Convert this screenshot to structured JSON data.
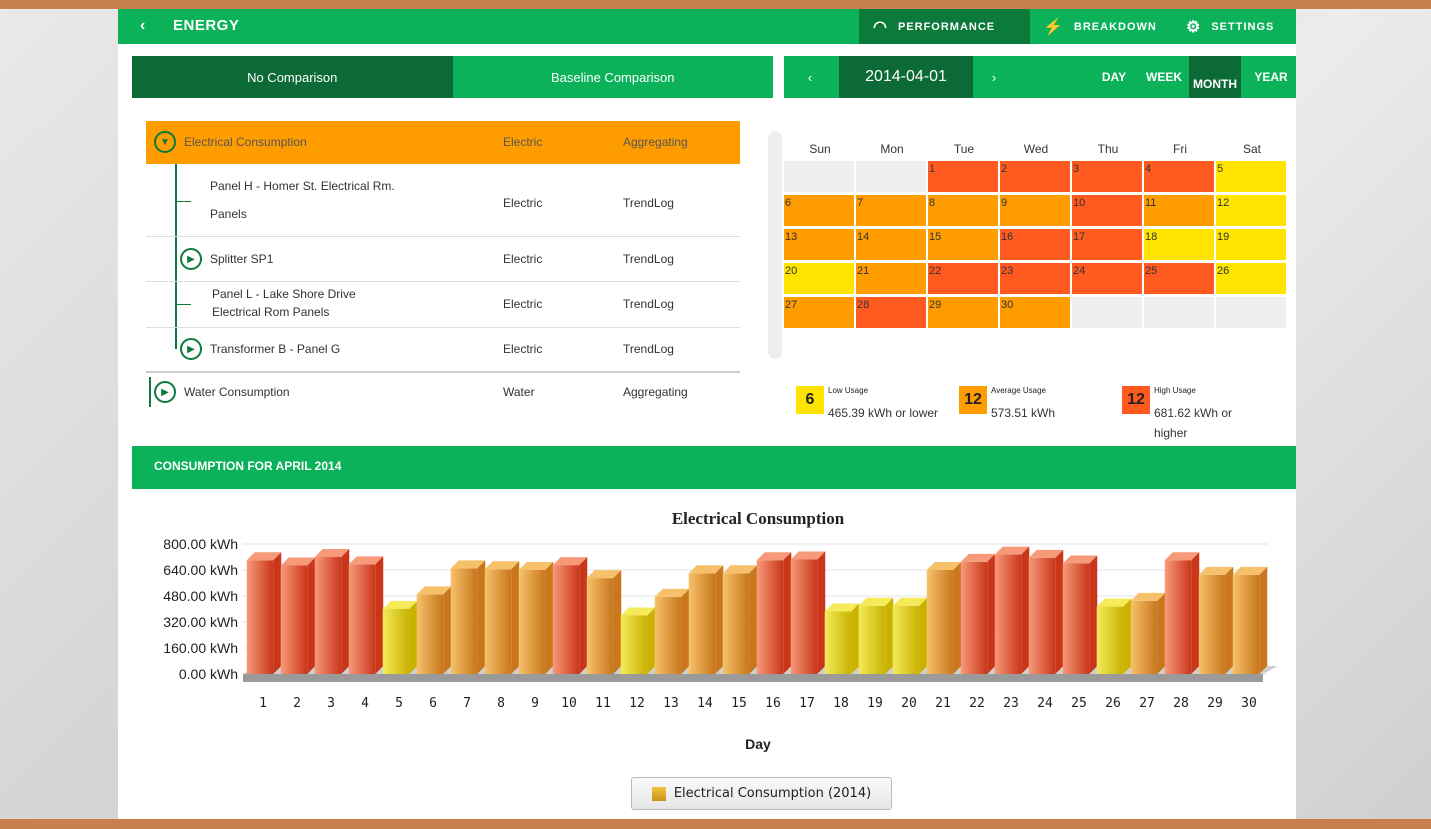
{
  "header": {
    "back_icon": "‹",
    "title": "ENERGY",
    "nav": [
      {
        "icon": "speedometer-icon",
        "label": "PERFORMANCE"
      },
      {
        "icon": "lightning-icon",
        "label": "BREAKDOWN"
      },
      {
        "icon": "gear-icon",
        "label": "SETTINGS"
      }
    ]
  },
  "comparison_tabs": [
    "No Comparison",
    "Baseline Comparison"
  ],
  "tree": [
    {
      "name": "Electrical Consumption",
      "type": "Electric",
      "mode": "Aggregating"
    },
    {
      "name_line1": "Panel H - Homer St. Electrical Rm.",
      "name_line2": "Panels",
      "type": "Electric",
      "mode": "TrendLog"
    },
    {
      "name": "Splitter SP1",
      "type": "Electric",
      "mode": "TrendLog"
    },
    {
      "name_line1": "Panel L - Lake Shore Drive",
      "name_line2": "Electrical Rom Panels",
      "type": "Electric",
      "mode": "TrendLog"
    },
    {
      "name": "Transformer B - Panel G",
      "type": "Electric",
      "mode": "TrendLog"
    },
    {
      "name": "Water Consumption",
      "type": "Water",
      "mode": "Aggregating"
    }
  ],
  "calendar": {
    "prev": "‹",
    "date": "2014-04-01",
    "next": "›",
    "views": {
      "day": "DAY",
      "week": "WEEK",
      "month": "MONTH",
      "year": "YEAR"
    },
    "weekdays": [
      "Sun",
      "Mon",
      "Tue",
      "Wed",
      "Thu",
      "Fri",
      "Sat"
    ],
    "first_weekday": 2,
    "days": [
      {
        "d": "1",
        "l": "high"
      },
      {
        "d": "2",
        "l": "high"
      },
      {
        "d": "3",
        "l": "high"
      },
      {
        "d": "4",
        "l": "high"
      },
      {
        "d": "5",
        "l": "low"
      },
      {
        "d": "6",
        "l": "avg"
      },
      {
        "d": "7",
        "l": "avg"
      },
      {
        "d": "8",
        "l": "avg"
      },
      {
        "d": "9",
        "l": "avg"
      },
      {
        "d": "10",
        "l": "high"
      },
      {
        "d": "11",
        "l": "avg"
      },
      {
        "d": "12",
        "l": "low"
      },
      {
        "d": "13",
        "l": "avg"
      },
      {
        "d": "14",
        "l": "avg"
      },
      {
        "d": "15",
        "l": "avg"
      },
      {
        "d": "16",
        "l": "high"
      },
      {
        "d": "17",
        "l": "high"
      },
      {
        "d": "18",
        "l": "low"
      },
      {
        "d": "19",
        "l": "low"
      },
      {
        "d": "20",
        "l": "low"
      },
      {
        "d": "21",
        "l": "avg"
      },
      {
        "d": "22",
        "l": "high"
      },
      {
        "d": "23",
        "l": "high"
      },
      {
        "d": "24",
        "l": "high"
      },
      {
        "d": "25",
        "l": "high"
      },
      {
        "d": "26",
        "l": "low"
      },
      {
        "d": "27",
        "l": "avg"
      },
      {
        "d": "28",
        "l": "high"
      },
      {
        "d": "29",
        "l": "avg"
      },
      {
        "d": "30",
        "l": "avg"
      }
    ],
    "colors": {
      "low": "#ffe400",
      "avg": "#ff9c00",
      "high": "#ff5a1f"
    },
    "legend": [
      {
        "count": "6",
        "title": "Low Usage",
        "value": "465.39 kWh or lower",
        "color": "#ffe400"
      },
      {
        "count": "12",
        "title": "Average Usage",
        "value": "573.51 kWh",
        "color": "#ff9c00"
      },
      {
        "count": "12",
        "title": "High Usage",
        "value": "681.62 kWh or",
        "value2": "higher",
        "color": "#ff5a1f"
      }
    ]
  },
  "consumption_header": "CONSUMPTION FOR APRIL 2014",
  "chart_data": {
    "type": "bar",
    "title": "Electrical Consumption",
    "xlabel": "Day",
    "ylabel": "",
    "ylim": [
      0,
      800
    ],
    "yticks": [
      "800.00 kWh",
      "640.00 kWh",
      "480.00 kWh",
      "320.00 kWh",
      "160.00 kWh",
      "0.00 kWh"
    ],
    "categories": [
      "1",
      "2",
      "3",
      "4",
      "5",
      "6",
      "7",
      "8",
      "9",
      "10",
      "11",
      "12",
      "13",
      "14",
      "15",
      "16",
      "17",
      "18",
      "19",
      "20",
      "21",
      "22",
      "23",
      "24",
      "25",
      "26",
      "27",
      "28",
      "29",
      "30"
    ],
    "series": [
      {
        "name": "Electrical Consumption (2014)",
        "values": [
          700,
          668,
          720,
          675,
          400,
          490,
          650,
          645,
          640,
          670,
          590,
          360,
          475,
          620,
          620,
          700,
          705,
          385,
          420,
          420,
          640,
          690,
          735,
          715,
          680,
          415,
          450,
          700,
          610,
          610
        ]
      }
    ],
    "bar_colors": {
      "low": "#e6d21c",
      "avg": "#f2a33a",
      "high": "#f06a3d"
    }
  }
}
